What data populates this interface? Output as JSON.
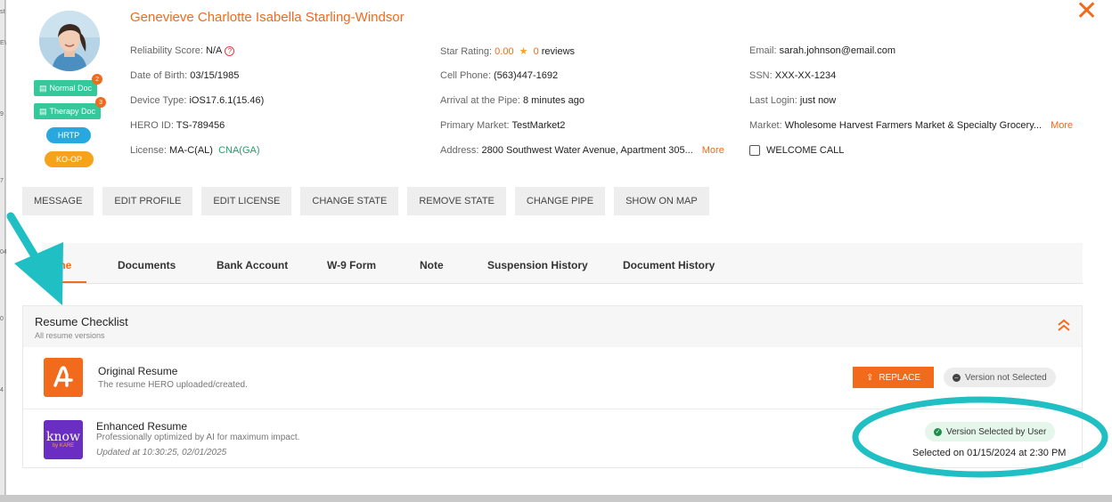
{
  "profile": {
    "name": "Genevieve Charlotte Isabella Starling-Windsor",
    "badges": {
      "normal_doc": {
        "label": "Normal Doc",
        "count": "2"
      },
      "therapy_doc": {
        "label": "Therapy Doc",
        "count": "3"
      },
      "hrtp": "HRTP",
      "koop": "KO-OP"
    },
    "col1": {
      "reliability_label": "Reliability Score:",
      "reliability_value": "N/A",
      "dob_label": "Date of Birth:",
      "dob_value": "03/15/1985",
      "device_label": "Device Type:",
      "device_value": "iOS17.6.1(15.46)",
      "hero_label": "HERO ID:",
      "hero_value": "TS-789456",
      "license_label": "License:",
      "license_value": "MA-C(AL)",
      "license_extra": "CNA(GA)"
    },
    "col2": {
      "star_label": "Star Rating:",
      "star_value": "0.00",
      "star_reviews_count": "0",
      "star_reviews_word": "reviews",
      "phone_label": "Cell Phone:",
      "phone_value": "(563)447-1692",
      "arrival_label": "Arrival at the Pipe:",
      "arrival_value": "8 minutes ago",
      "market_label": "Primary Market:",
      "market_value": "TestMarket2",
      "address_label": "Address:",
      "address_value": "2800 Southwest Water Avenue, Apartment 305...",
      "address_more": "More"
    },
    "col3": {
      "email_label": "Email:",
      "email_value": "sarah.johnson@email.com",
      "ssn_label": "SSN:",
      "ssn_value": "XXX-XX-1234",
      "login_label": "Last Login:",
      "login_value": "just now",
      "mkt_label": "Market:",
      "mkt_value": "Wholesome Harvest Farmers Market & Specialty Grocery...",
      "mkt_more": "More",
      "welcome_call": "WELCOME CALL"
    }
  },
  "actions": [
    "MESSAGE",
    "EDIT PROFILE",
    "EDIT LICENSE",
    "CHANGE STATE",
    "REMOVE STATE",
    "CHANGE PIPE",
    "SHOW ON MAP"
  ],
  "tabs": {
    "resume": "me",
    "documents": "Documents",
    "bank": "Bank Account",
    "w9": "W-9 Form",
    "note": "Note",
    "suspension": "Suspension History",
    "doc_history": "Document History"
  },
  "checklist": {
    "title": "Resume Checklist",
    "subtitle": "All resume versions",
    "original": {
      "title": "Original Resume",
      "subtitle": "The resume HERO uploaded/created.",
      "replace": "REPLACE",
      "status": "Version not Selected"
    },
    "enhanced": {
      "title": "Enhanced Resume",
      "subtitle": "Professionally optimized by AI for maximum impact.",
      "updated": "Updated at 10:30:25, 02/01/2025",
      "logo_text": "know",
      "logo_sub": "by KARE",
      "status": "Version Selected by User",
      "selected_on": "Selected on 01/15/2024 at 2:30 PM"
    }
  },
  "colors": {
    "accent": "#f26a1b",
    "teal_annotation": "#1fbfc4",
    "green_badge": "#34c89a",
    "blue_pill": "#29a8e0",
    "orange_pill": "#f7a21b",
    "purple_logo": "#6a2fc2"
  },
  "icons": [
    "close-icon",
    "help-icon",
    "star-icon",
    "doc-icon",
    "chevron-double-up-icon",
    "upload-icon",
    "check-circle-icon",
    "minus-circle-icon"
  ]
}
